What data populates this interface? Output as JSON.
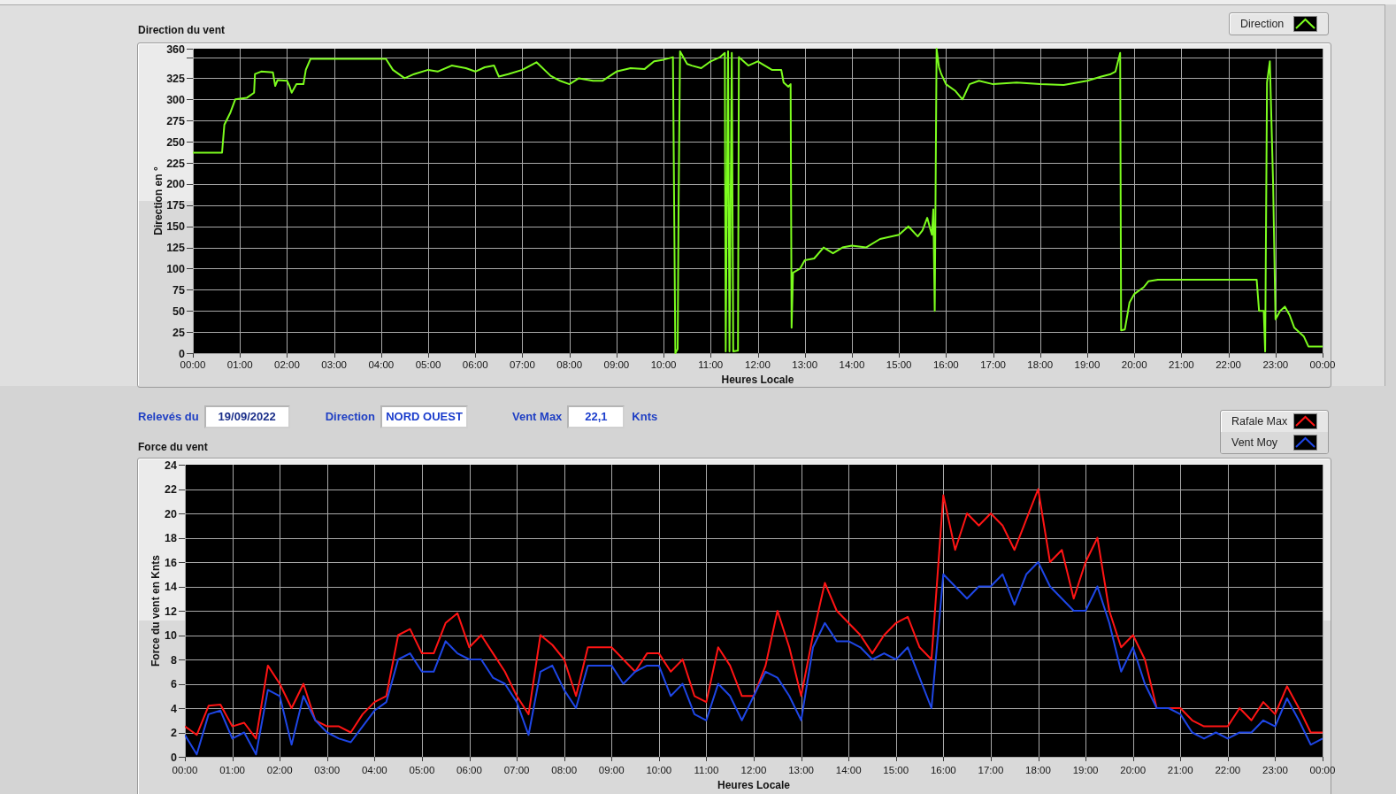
{
  "direction_chart": {
    "chart_data": {
      "type": "line",
      "title": "Direction du vent",
      "xlabel": "Heures Locale",
      "ylabel": "Direction en °",
      "grid": true,
      "x": [
        0,
        0.6,
        0.62,
        0.67,
        0.8,
        0.9,
        1.0,
        1.15,
        1.3,
        1.32,
        1.45,
        1.7,
        1.75,
        1.8,
        2.0,
        2.05,
        2.1,
        2.2,
        2.35,
        2.4,
        2.5,
        3.0,
        4.0,
        4.1,
        4.25,
        4.5,
        4.7,
        5.0,
        5.2,
        5.5,
        5.8,
        6.0,
        6.2,
        6.4,
        6.5,
        6.7,
        7.0,
        7.3,
        7.6,
        7.8,
        8.0,
        8.2,
        8.5,
        8.7,
        9.0,
        9.3,
        9.6,
        9.8,
        10.0,
        10.2,
        10.25,
        10.3,
        10.32,
        10.35,
        10.5,
        10.6,
        10.8,
        11.0,
        11.2,
        11.3,
        11.32,
        11.37,
        11.4,
        11.45,
        11.48,
        11.58,
        11.6,
        11.7,
        11.8,
        12.0,
        12.3,
        12.5,
        12.55,
        12.65,
        12.7,
        12.72,
        12.75,
        12.9,
        13.0,
        13.2,
        13.4,
        13.6,
        13.8,
        14.0,
        14.3,
        14.6,
        15.0,
        15.2,
        15.4,
        15.5,
        15.6,
        15.7,
        15.73,
        15.76,
        15.8,
        15.85,
        15.9,
        16.0,
        16.2,
        16.35,
        16.5,
        16.7,
        17.0,
        17.5,
        18.0,
        18.5,
        19.0,
        19.3,
        19.5,
        19.6,
        19.7,
        19.72,
        19.8,
        19.9,
        20.0,
        20.2,
        20.3,
        20.5,
        22.6,
        22.65,
        22.75,
        22.78,
        22.82,
        22.88,
        22.95,
        23.0,
        23.1,
        23.2,
        23.3,
        23.4,
        23.6,
        23.7,
        24.0
      ],
      "series": [
        {
          "name": "Direction",
          "color": "#7cfc1e",
          "values": [
            237,
            237,
            237,
            270,
            285,
            300,
            301,
            302,
            308,
            330,
            333,
            332,
            316,
            323,
            322,
            316,
            308,
            318,
            318,
            335,
            348,
            348,
            348,
            348,
            335,
            325,
            330,
            335,
            333,
            340,
            337,
            333,
            338,
            340,
            327,
            330,
            335,
            344,
            328,
            322,
            318,
            325,
            322,
            322,
            333,
            337,
            336,
            345,
            347,
            350,
            0,
            5,
            180,
            357,
            342,
            340,
            337,
            345,
            350,
            355,
            2,
            357,
            2,
            355,
            2,
            3,
            350,
            345,
            340,
            345,
            335,
            335,
            320,
            315,
            318,
            30,
            95,
            100,
            110,
            112,
            125,
            118,
            125,
            127,
            125,
            135,
            140,
            150,
            138,
            145,
            160,
            140,
            170,
            50,
            360,
            338,
            330,
            318,
            310,
            300,
            318,
            322,
            318,
            320,
            318,
            317,
            322,
            327,
            330,
            333,
            355,
            27,
            28,
            60,
            70,
            78,
            85,
            87,
            87,
            50,
            50,
            2,
            320,
            345,
            200,
            40,
            50,
            55,
            45,
            30,
            20,
            8,
            8
          ]
        }
      ],
      "xlim": [
        0,
        24
      ],
      "ylim": [
        0,
        360
      ],
      "xticks": [
        {
          "value": 0,
          "label": "00:00"
        },
        {
          "value": 1,
          "label": "01:00"
        },
        {
          "value": 2,
          "label": "02:00"
        },
        {
          "value": 3,
          "label": "03:00"
        },
        {
          "value": 4,
          "label": "04:00"
        },
        {
          "value": 5,
          "label": "05:00"
        },
        {
          "value": 6,
          "label": "06:00"
        },
        {
          "value": 7,
          "label": "07:00"
        },
        {
          "value": 8,
          "label": "08:00"
        },
        {
          "value": 9,
          "label": "09:00"
        },
        {
          "value": 10,
          "label": "10:00"
        },
        {
          "value": 11,
          "label": "11:00"
        },
        {
          "value": 12,
          "label": "12:00"
        },
        {
          "value": 13,
          "label": "13:00"
        },
        {
          "value": 14,
          "label": "14:00"
        },
        {
          "value": 15,
          "label": "15:00"
        },
        {
          "value": 16,
          "label": "16:00"
        },
        {
          "value": 17,
          "label": "17:00"
        },
        {
          "value": 18,
          "label": "18:00"
        },
        {
          "value": 19,
          "label": "19:00"
        },
        {
          "value": 20,
          "label": "20:00"
        },
        {
          "value": 21,
          "label": "21:00"
        },
        {
          "value": 22,
          "label": "22:00"
        },
        {
          "value": 23,
          "label": "23:00"
        },
        {
          "value": 24,
          "label": "00:00"
        }
      ],
      "yticks": [
        0,
        25,
        50,
        75,
        100,
        125,
        150,
        175,
        200,
        225,
        250,
        275,
        300,
        325,
        360
      ]
    }
  },
  "readings": [
    {
      "label": "Relevés du",
      "value": "19/09/2022"
    },
    {
      "label": "Direction",
      "value": "NORD OUEST"
    },
    {
      "label": "Vent Max",
      "value": "22,1",
      "unit": "Knts"
    }
  ],
  "force_chart": {
    "chart_data": {
      "type": "line",
      "title": "Force du vent",
      "xlabel": "Heures Locale",
      "ylabel": "Force du vent en Knts",
      "grid": true,
      "x": [
        0,
        0.25,
        0.5,
        0.75,
        1,
        1.25,
        1.5,
        1.75,
        2,
        2.25,
        2.5,
        2.75,
        3,
        3.25,
        3.5,
        3.75,
        4,
        4.25,
        4.5,
        4.75,
        5,
        5.25,
        5.5,
        5.75,
        6,
        6.25,
        6.5,
        6.75,
        7,
        7.25,
        7.5,
        7.75,
        8,
        8.25,
        8.5,
        8.75,
        9,
        9.25,
        9.5,
        9.75,
        10,
        10.25,
        10.5,
        10.75,
        11,
        11.25,
        11.5,
        11.75,
        12,
        12.25,
        12.5,
        12.75,
        13,
        13.25,
        13.5,
        13.75,
        14,
        14.25,
        14.5,
        14.75,
        15,
        15.25,
        15.5,
        15.75,
        16,
        16.25,
        16.5,
        16.75,
        17,
        17.25,
        17.5,
        17.75,
        18,
        18.25,
        18.5,
        18.75,
        19,
        19.25,
        19.5,
        19.75,
        20,
        20.25,
        20.5,
        20.75,
        21,
        21.25,
        21.5,
        21.75,
        22,
        22.25,
        22.5,
        22.75,
        23,
        23.25,
        23.5,
        23.75,
        24
      ],
      "series": [
        {
          "name": "Rafale Max",
          "color": "#ff1414",
          "values": [
            2.5,
            1.8,
            4.2,
            4.3,
            2.5,
            2.8,
            1.5,
            7.5,
            6,
            4,
            6,
            3,
            2.5,
            2.5,
            2,
            3.5,
            4.5,
            5,
            10,
            10.5,
            8.5,
            8.5,
            11,
            11.8,
            9,
            10,
            8.5,
            7,
            5,
            3.5,
            10,
            9.2,
            8,
            5,
            9,
            9,
            9,
            8,
            7,
            8.5,
            8.5,
            7,
            8,
            5,
            4.5,
            9,
            7.5,
            5,
            5,
            7.5,
            12,
            9,
            5,
            10,
            14.3,
            12,
            11,
            10,
            8.5,
            10,
            11,
            11.5,
            9,
            8,
            21.5,
            17,
            20,
            19,
            20,
            19,
            17,
            19.5,
            22,
            16,
            17,
            13,
            16,
            18,
            12,
            9,
            10,
            8,
            4,
            4,
            4,
            3,
            2.5,
            2.5,
            2.5,
            4,
            3,
            4.5,
            3.5,
            5.8,
            4,
            2,
            2
          ]
        },
        {
          "name": "Vent Moy",
          "color": "#1e46e6",
          "values": [
            1.8,
            0.2,
            3.5,
            3.8,
            1.5,
            2,
            0.2,
            5.5,
            5,
            1,
            5,
            3,
            2,
            1.5,
            1.2,
            2.5,
            3.8,
            4.5,
            8,
            8.5,
            7,
            7,
            9.5,
            8.5,
            8,
            8,
            6.5,
            6,
            4.5,
            1.8,
            7,
            7.5,
            5.5,
            4,
            7.5,
            7.5,
            7.5,
            6,
            7,
            7.5,
            7.5,
            5,
            6,
            3.5,
            3,
            6,
            5,
            3,
            5,
            7,
            6.5,
            5,
            3,
            9,
            11,
            9.5,
            9.5,
            9,
            8,
            8.5,
            8,
            9,
            6.5,
            4,
            15,
            14,
            13,
            14,
            14,
            15,
            12.5,
            15,
            16,
            14,
            13,
            12,
            12,
            14,
            11,
            7,
            9,
            6,
            4,
            4,
            3.5,
            2,
            1.5,
            2,
            1.5,
            2,
            2,
            3,
            2.5,
            4.8,
            3,
            1,
            1.5
          ]
        }
      ],
      "xlim": [
        0,
        24
      ],
      "ylim": [
        0,
        24
      ],
      "xticks": [
        {
          "value": 0,
          "label": "00:00"
        },
        {
          "value": 1,
          "label": "01:00"
        },
        {
          "value": 2,
          "label": "02:00"
        },
        {
          "value": 3,
          "label": "03:00"
        },
        {
          "value": 4,
          "label": "04:00"
        },
        {
          "value": 5,
          "label": "05:00"
        },
        {
          "value": 6,
          "label": "06:00"
        },
        {
          "value": 7,
          "label": "07:00"
        },
        {
          "value": 8,
          "label": "08:00"
        },
        {
          "value": 9,
          "label": "09:00"
        },
        {
          "value": 10,
          "label": "10:00"
        },
        {
          "value": 11,
          "label": "11:00"
        },
        {
          "value": 12,
          "label": "12:00"
        },
        {
          "value": 13,
          "label": "13:00"
        },
        {
          "value": 14,
          "label": "14:00"
        },
        {
          "value": 15,
          "label": "15:00"
        },
        {
          "value": 16,
          "label": "16:00"
        },
        {
          "value": 17,
          "label": "17:00"
        },
        {
          "value": 18,
          "label": "18:00"
        },
        {
          "value": 19,
          "label": "19:00"
        },
        {
          "value": 20,
          "label": "20:00"
        },
        {
          "value": 21,
          "label": "21:00"
        },
        {
          "value": 22,
          "label": "22:00"
        },
        {
          "value": 23,
          "label": "23:00"
        },
        {
          "value": 24,
          "label": "00:00"
        }
      ],
      "yticks": [
        0,
        2,
        4,
        6,
        8,
        10,
        12,
        14,
        16,
        18,
        20,
        22,
        24
      ]
    }
  }
}
